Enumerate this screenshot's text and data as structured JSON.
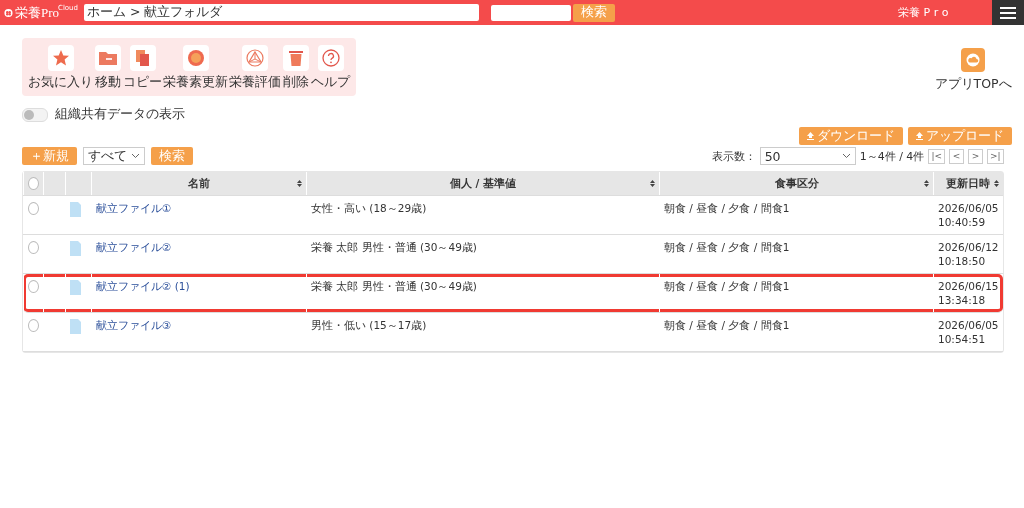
{
  "header": {
    "logo": {
      "text": "栄養Pro",
      "badge": "Cloud"
    },
    "breadcrumb": "ホーム > 献立フォルダ",
    "search_button": "検索",
    "user": "栄養 P r o"
  },
  "toolbar": [
    {
      "kind": "star",
      "label": "お気に入り"
    },
    {
      "kind": "move",
      "label": "移動"
    },
    {
      "kind": "copy",
      "label": "コピー"
    },
    {
      "kind": "update",
      "label": "栄養素更新"
    },
    {
      "kind": "evaluate",
      "label": "栄養評価"
    },
    {
      "kind": "delete",
      "label": "削除"
    },
    {
      "kind": "help",
      "label": "ヘルプ"
    }
  ],
  "app_top": {
    "label": "アプリTOPへ"
  },
  "shared_toggle": {
    "label": "組織共有データの表示",
    "on": false
  },
  "actions": {
    "new_button": "＋新規",
    "filter": "すべて",
    "search_button": "検索",
    "download_button": "ダウンロード",
    "upload_button": "アップロード"
  },
  "pagination": {
    "label": "表示数：",
    "per_page": "50",
    "range": "1～4件 / 4件",
    "buttons": [
      "|<",
      "<",
      ">",
      ">|"
    ]
  },
  "table": {
    "all_selected": false,
    "columns": [
      "名前",
      "個人 / 基準値",
      "食事区分",
      "更新日時"
    ],
    "rows": [
      {
        "name": "献立ファイル①",
        "person": "女性・高い (18～29歳)",
        "meals": "朝食 / 昼食 / 夕食 / 間食1",
        "date": "2026/06/05",
        "time": "10:40:59",
        "highlighted": false,
        "selected": false
      },
      {
        "name": "献立ファイル②",
        "person": "栄養 太郎 男性・普通 (30～49歳)",
        "meals": "朝食 / 昼食 / 夕食 / 間食1",
        "date": "2026/06/12",
        "time": "10:18:50",
        "highlighted": false,
        "selected": false
      },
      {
        "name": "献立ファイル② (1)",
        "person": "栄養 太郎 男性・普通 (30～49歳)",
        "meals": "朝食 / 昼食 / 夕食 / 間食1",
        "date": "2026/06/15",
        "time": "13:34:18",
        "highlighted": true,
        "selected": false
      },
      {
        "name": "献立ファイル③",
        "person": "男性・低い (15～17歳)",
        "meals": "朝食 / 昼食 / 夕食 / 間食1",
        "date": "2026/06/05",
        "time": "10:54:51",
        "highlighted": false,
        "selected": false
      }
    ]
  }
}
